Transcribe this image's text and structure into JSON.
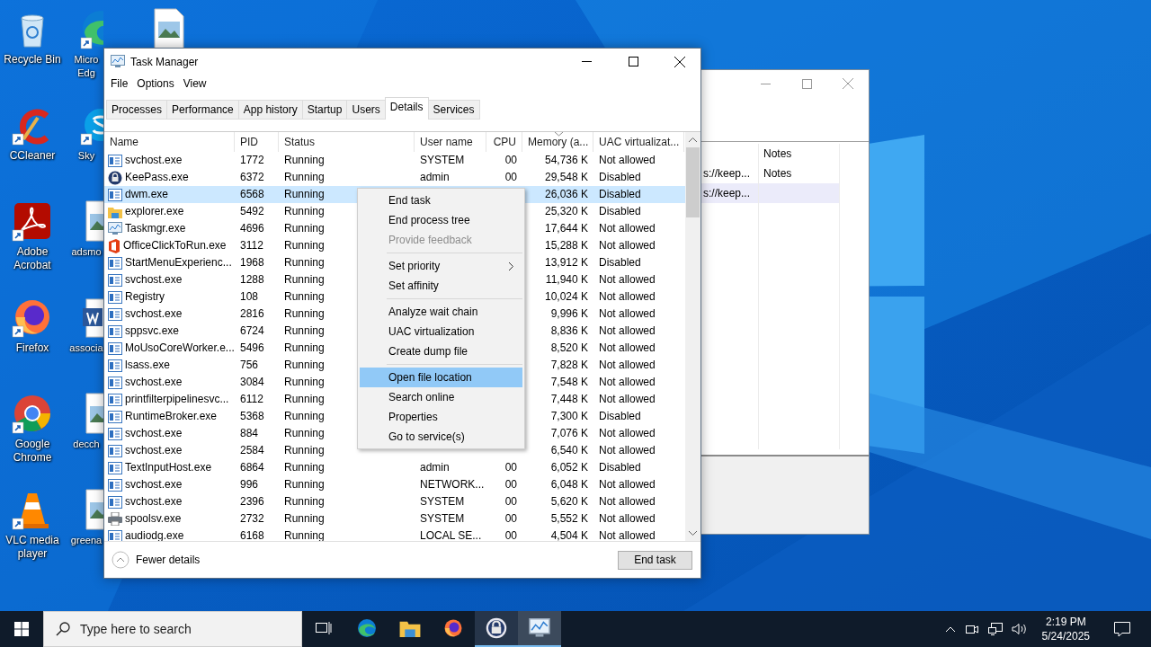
{
  "desktop": {
    "columns": [
      [
        {
          "label": "Recycle Bin",
          "kind": "recycle-bin",
          "shortcut": false
        },
        {
          "label": "CCleaner",
          "kind": "ccleaner",
          "shortcut": true
        },
        {
          "label": "Adobe Acrobat",
          "kind": "acrobat",
          "shortcut": true
        },
        {
          "label": "Firefox",
          "kind": "firefox",
          "shortcut": true
        },
        {
          "label": "Google Chrome",
          "kind": "chrome",
          "shortcut": true
        },
        {
          "label": "VLC media player",
          "kind": "vlc",
          "shortcut": true
        }
      ],
      [
        {
          "label": "Micro Edg",
          "kind": "edge",
          "shortcut": true
        },
        {
          "label": "Sky",
          "kind": "skype",
          "shortcut": true
        },
        {
          "label": "adsmo",
          "kind": "image-file",
          "shortcut": false
        },
        {
          "label": "associa",
          "kind": "word",
          "shortcut": false
        },
        {
          "label": "decch",
          "kind": "image-file",
          "shortcut": false
        },
        {
          "label": "greena",
          "kind": "image-file",
          "shortcut": false
        }
      ],
      [
        {
          "kind": "image-file",
          "shortcut": false
        }
      ]
    ]
  },
  "background_window": {
    "columns": [
      {
        "label": "Notes"
      }
    ],
    "rows": [
      {
        "column_1": "s://keep...",
        "notes": "Notes",
        "selected": false
      },
      {
        "column_1": "s://keep...",
        "selected": true
      }
    ]
  },
  "task_manager": {
    "title": "Task Manager",
    "menu": [
      "File",
      "Options",
      "View"
    ],
    "tabs": [
      {
        "label": "Processes",
        "selected": false
      },
      {
        "label": "Performance",
        "selected": false
      },
      {
        "label": "App history",
        "selected": false
      },
      {
        "label": "Startup",
        "selected": false
      },
      {
        "label": "Users",
        "selected": false
      },
      {
        "label": "Details",
        "selected": true
      },
      {
        "label": "Services",
        "selected": false
      }
    ],
    "table": {
      "columns": [
        {
          "label": "Name",
          "sorted": false
        },
        {
          "label": "PID",
          "sorted": false
        },
        {
          "label": "Status",
          "sorted": false
        },
        {
          "label": "User name",
          "sorted": false
        },
        {
          "label": "CPU",
          "sorted": false
        },
        {
          "label": "Memory (a...",
          "sorted": true
        },
        {
          "label": "UAC virtualizat...",
          "sorted": false
        }
      ],
      "rows": [
        {
          "kind": "service",
          "name": "svchost.exe",
          "pid": "1772",
          "status": "Running",
          "user": "SYSTEM",
          "cpu": "00",
          "memory": "54,736 K",
          "uac": "Not allowed",
          "selected": false
        },
        {
          "kind": "keepass",
          "name": "KeePass.exe",
          "pid": "6372",
          "status": "Running",
          "user": "admin",
          "cpu": "00",
          "memory": "29,548 K",
          "uac": "Disabled",
          "selected": false
        },
        {
          "kind": "service",
          "name": "dwm.exe",
          "pid": "6568",
          "status": "Running",
          "memory": "26,036 K",
          "uac": "Disabled",
          "selected": true
        },
        {
          "kind": "explorer",
          "name": "explorer.exe",
          "pid": "5492",
          "status": "Running",
          "memory": "25,320 K",
          "uac": "Disabled",
          "selected": false
        },
        {
          "kind": "taskmgr",
          "name": "Taskmgr.exe",
          "pid": "4696",
          "status": "Running",
          "memory": "17,644 K",
          "uac": "Not allowed",
          "selected": false
        },
        {
          "kind": "office",
          "name": "OfficeClickToRun.exe",
          "pid": "3112",
          "status": "Running",
          "memory": "15,288 K",
          "uac": "Not allowed",
          "selected": false
        },
        {
          "kind": "service",
          "name": "StartMenuExperienc...",
          "pid": "1968",
          "status": "Running",
          "memory": "13,912 K",
          "uac": "Disabled",
          "selected": false
        },
        {
          "kind": "service",
          "name": "svchost.exe",
          "pid": "1288",
          "status": "Running",
          "memory": "11,940 K",
          "uac": "Not allowed",
          "selected": false
        },
        {
          "kind": "service",
          "name": "Registry",
          "pid": "108",
          "status": "Running",
          "memory": "10,024 K",
          "uac": "Not allowed",
          "selected": false
        },
        {
          "kind": "service",
          "name": "svchost.exe",
          "pid": "2816",
          "status": "Running",
          "memory": "9,996 K",
          "uac": "Not allowed",
          "selected": false
        },
        {
          "kind": "service",
          "name": "sppsvc.exe",
          "pid": "6724",
          "status": "Running",
          "memory": "8,836 K",
          "uac": "Not allowed",
          "selected": false
        },
        {
          "kind": "service",
          "name": "MoUsoCoreWorker.e...",
          "pid": "5496",
          "status": "Running",
          "memory": "8,520 K",
          "uac": "Not allowed",
          "selected": false
        },
        {
          "kind": "service",
          "name": "lsass.exe",
          "pid": "756",
          "status": "Running",
          "memory": "7,828 K",
          "uac": "Not allowed",
          "selected": false
        },
        {
          "kind": "service",
          "name": "svchost.exe",
          "pid": "3084",
          "status": "Running",
          "memory": "7,548 K",
          "uac": "Not allowed",
          "selected": false
        },
        {
          "kind": "service",
          "name": "printfilterpipelinesvc...",
          "pid": "6112",
          "status": "Running",
          "memory": "7,448 K",
          "uac": "Not allowed",
          "selected": false
        },
        {
          "kind": "service",
          "name": "RuntimeBroker.exe",
          "pid": "5368",
          "status": "Running",
          "memory": "7,300 K",
          "uac": "Disabled",
          "selected": false
        },
        {
          "kind": "service",
          "name": "svchost.exe",
          "pid": "884",
          "status": "Running",
          "memory": "7,076 K",
          "uac": "Not allowed",
          "selected": false
        },
        {
          "kind": "service",
          "name": "svchost.exe",
          "pid": "2584",
          "status": "Running",
          "memory": "6,540 K",
          "uac": "Not allowed",
          "selected": false
        },
        {
          "kind": "service",
          "name": "TextInputHost.exe",
          "pid": "6864",
          "status": "Running",
          "user": "admin",
          "cpu": "00",
          "memory": "6,052 K",
          "uac": "Disabled",
          "selected": false
        },
        {
          "kind": "service",
          "name": "svchost.exe",
          "pid": "996",
          "status": "Running",
          "user": "NETWORK...",
          "cpu": "00",
          "memory": "6,048 K",
          "uac": "Not allowed",
          "selected": false
        },
        {
          "kind": "service",
          "name": "svchost.exe",
          "pid": "2396",
          "status": "Running",
          "user": "SYSTEM",
          "cpu": "00",
          "memory": "5,620 K",
          "uac": "Not allowed",
          "selected": false
        },
        {
          "kind": "printer",
          "name": "spoolsv.exe",
          "pid": "2732",
          "status": "Running",
          "user": "SYSTEM",
          "cpu": "00",
          "memory": "5,552 K",
          "uac": "Not allowed",
          "selected": false
        },
        {
          "kind": "service",
          "name": "audiodg.exe",
          "pid": "6168",
          "status": "Running",
          "user": "LOCAL SE...",
          "cpu": "00",
          "memory": "4,504 K",
          "uac": "Not allowed",
          "selected": false
        }
      ]
    },
    "context_menu": {
      "groups": [
        [
          {
            "label": "End task",
            "disabled": false,
            "submenu": false,
            "selected": false
          },
          {
            "label": "End process tree",
            "disabled": false,
            "submenu": false,
            "selected": false
          },
          {
            "label": "Provide feedback",
            "disabled": true,
            "submenu": false,
            "selected": false
          }
        ],
        [
          {
            "label": "Set priority",
            "disabled": false,
            "submenu": true,
            "selected": false
          },
          {
            "label": "Set affinity",
            "disabled": false,
            "submenu": false,
            "selected": false
          }
        ],
        [
          {
            "label": "Analyze wait chain",
            "disabled": false,
            "submenu": false,
            "selected": false
          },
          {
            "label": "UAC virtualization",
            "disabled": false,
            "submenu": false,
            "selected": false
          },
          {
            "label": "Create dump file",
            "disabled": false,
            "submenu": false,
            "selected": false
          }
        ],
        [
          {
            "label": "Open file location",
            "disabled": false,
            "submenu": false,
            "selected": true
          },
          {
            "label": "Search online",
            "disabled": false,
            "submenu": false,
            "selected": false
          },
          {
            "label": "Properties",
            "disabled": false,
            "submenu": false,
            "selected": false
          },
          {
            "label": "Go to service(s)",
            "disabled": false,
            "submenu": false,
            "selected": false
          }
        ]
      ]
    },
    "footer": {
      "toggle": "Fewer details",
      "button": "End task"
    }
  },
  "taskbar": {
    "search": {
      "placeholder": "Type here to search"
    },
    "apps": [
      {
        "kind": "edge",
        "selected": false,
        "running": false
      },
      {
        "kind": "explorer",
        "selected": false,
        "running": false
      },
      {
        "kind": "firefox",
        "selected": false,
        "running": false
      },
      {
        "kind": "keepass",
        "selected": false,
        "running": true
      },
      {
        "kind": "taskmgr",
        "selected": true,
        "running": true
      }
    ],
    "clock": {
      "time": "2:19 PM",
      "date": "5/24/2025"
    }
  }
}
